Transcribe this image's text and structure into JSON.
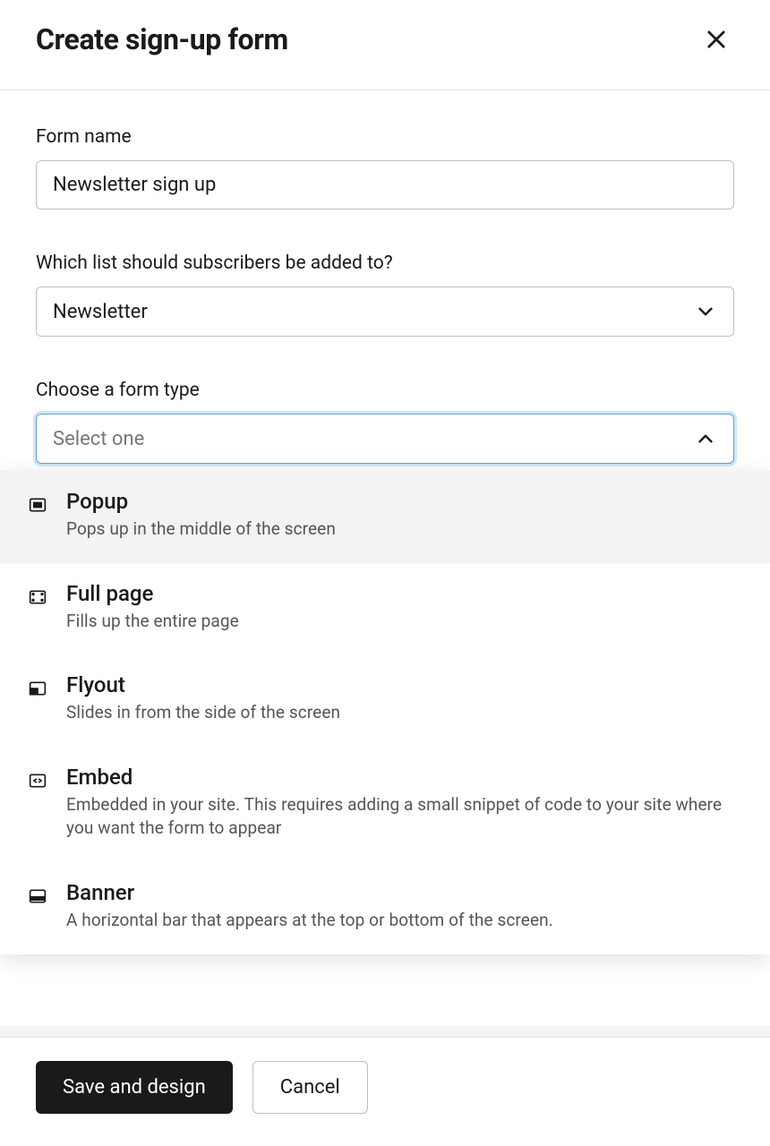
{
  "header": {
    "title": "Create sign-up form"
  },
  "fields": {
    "formName": {
      "label": "Form name",
      "value": "Newsletter sign up"
    },
    "list": {
      "label": "Which list should subscribers be added to?",
      "value": "Newsletter"
    },
    "formType": {
      "label": "Choose a form type",
      "placeholder": "Select one"
    }
  },
  "formTypeOptions": [
    {
      "title": "Popup",
      "desc": "Pops up in the middle of the screen",
      "highlight": true
    },
    {
      "title": "Full page",
      "desc": "Fills up the entire page"
    },
    {
      "title": "Flyout",
      "desc": "Slides in from the side of the screen"
    },
    {
      "title": "Embed",
      "desc": "Embedded in your site. This requires adding a small snippet of code to your site where you want the form to appear"
    },
    {
      "title": "Banner",
      "desc": "A horizontal bar that appears at the top or bottom of the screen."
    }
  ],
  "buttons": {
    "primary": "Save and design",
    "secondary": "Cancel"
  }
}
